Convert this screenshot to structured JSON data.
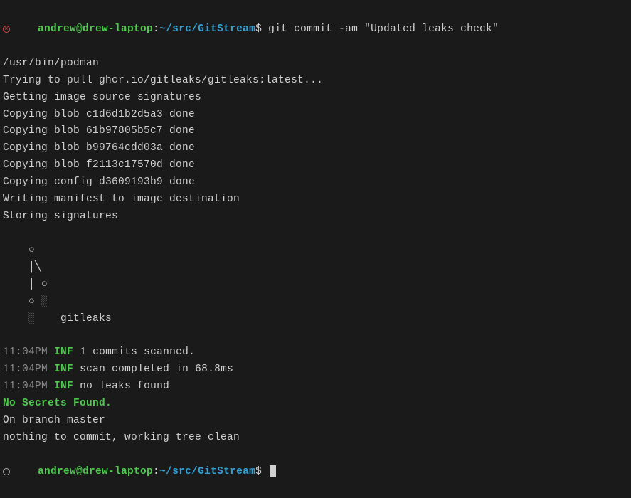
{
  "prompt1": {
    "user": "andrew@drew-laptop",
    "path": "~/src/GitStream",
    "dollar": "$",
    "command": "git commit -am \"Updated leaks check\""
  },
  "lines": [
    "/usr/bin/podman",
    "Trying to pull ghcr.io/gitleaks/gitleaks:latest...",
    "Getting image source signatures",
    "Copying blob c1d6d1b2d5a3 done",
    "Copying blob 61b97805b5c7 done",
    "Copying blob b99764cdd03a done",
    "Copying blob f2113c17570d done",
    "Copying config d3609193b9 done",
    "Writing manifest to image destination",
    "Storing signatures"
  ],
  "ascii": {
    "l1": "    ○",
    "l2": "    │╲",
    "l3": "    │ ○",
    "l4_a": "    ○ ",
    "l4_b": "░",
    "l5_a": "    ",
    "l5_b": "░",
    "l5_c": "    gitleaks"
  },
  "log": [
    {
      "time": "11:04PM",
      "level": "INF",
      "msg": "1 commits scanned."
    },
    {
      "time": "11:04PM",
      "level": "INF",
      "msg": "scan completed in 68.8ms"
    },
    {
      "time": "11:04PM",
      "level": "INF",
      "msg": "no leaks found"
    }
  ],
  "success_msg": "No Secrets Found.",
  "branch_line": "On branch master",
  "clean_line": "nothing to commit, working tree clean",
  "prompt2": {
    "user": "andrew@drew-laptop",
    "path": "~/src/GitStream",
    "dollar": "$"
  }
}
